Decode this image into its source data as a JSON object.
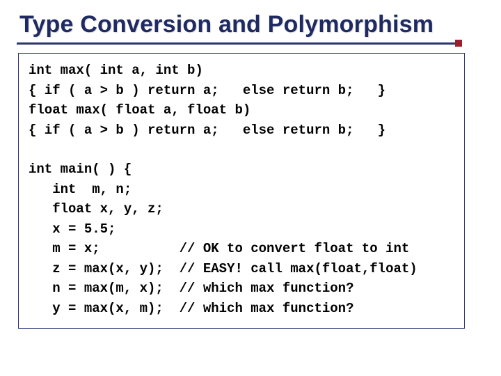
{
  "slide": {
    "title": "Type Conversion and Polymorphism",
    "code_block_1": "int max( int a, int b)\n{ if ( a > b ) return a;   else return b;   }\nfloat max( float a, float b)\n{ if ( a > b ) return a;   else return b;   }",
    "code_block_2": "int main( ) {\n   int  m, n;\n   float x, y, z;\n   x = 5.5;\n   m = x;          // OK to convert float to int\n   z = max(x, y);  // EASY! call max(float,float)\n   n = max(m, x);  // which max function?\n   y = max(x, m);  // which max function?"
  }
}
